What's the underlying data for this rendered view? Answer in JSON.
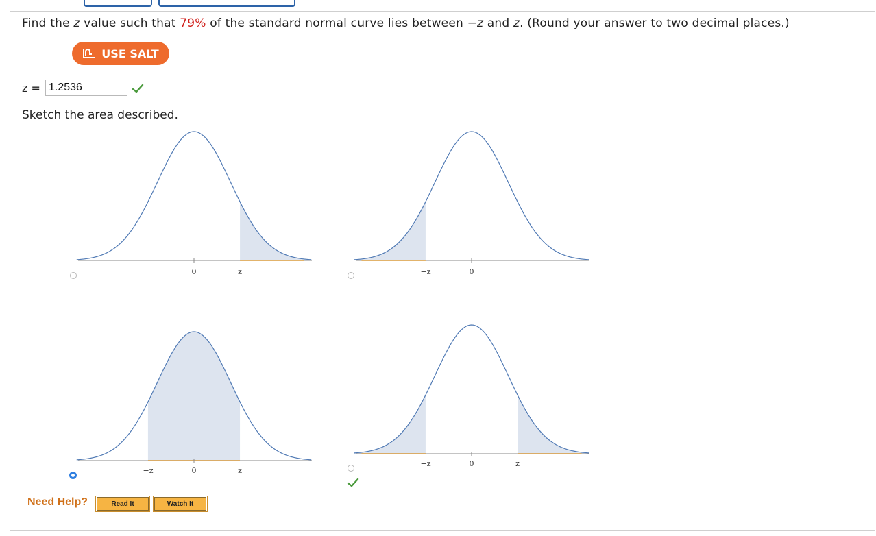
{
  "question": {
    "pre": "Find the ",
    "var1": "z",
    "mid1": " value such that ",
    "percent": "79%",
    "mid2": " of the standard normal curve lies between −",
    "var2": "z",
    "mid3": " and ",
    "var3": "z",
    "post": ". (Round your answer to two decimal places.)"
  },
  "salt_button": {
    "label": "USE SALT",
    "icon": "salt-chart-icon"
  },
  "answer": {
    "label": "z =",
    "value": "1.2536",
    "status": "correct"
  },
  "sketch_prompt": "Sketch the area described.",
  "options": [
    {
      "id": "A",
      "shade": "right-tail",
      "labels": [
        "0",
        "z"
      ],
      "selected": false
    },
    {
      "id": "B",
      "shade": "left-tail",
      "labels": [
        "−z",
        "0"
      ],
      "selected": false
    },
    {
      "id": "C",
      "shade": "center",
      "labels": [
        "−z",
        "0",
        "z"
      ],
      "selected": true
    },
    {
      "id": "D",
      "shade": "two-tails",
      "labels": [
        "−z",
        "0",
        "z"
      ],
      "selected": false,
      "status": "correct"
    }
  ],
  "help": {
    "label": "Need Help?",
    "read": "Read It",
    "watch": "Watch It"
  },
  "colors": {
    "curve": "#4f79b4",
    "fill": "#dde4ef",
    "axis": "#888888",
    "baseline_accent": "#d99a3a",
    "salt": "#ee6b2d",
    "check": "#4a9a3c",
    "radio": "#2f7fe0",
    "red": "#d0211c"
  }
}
